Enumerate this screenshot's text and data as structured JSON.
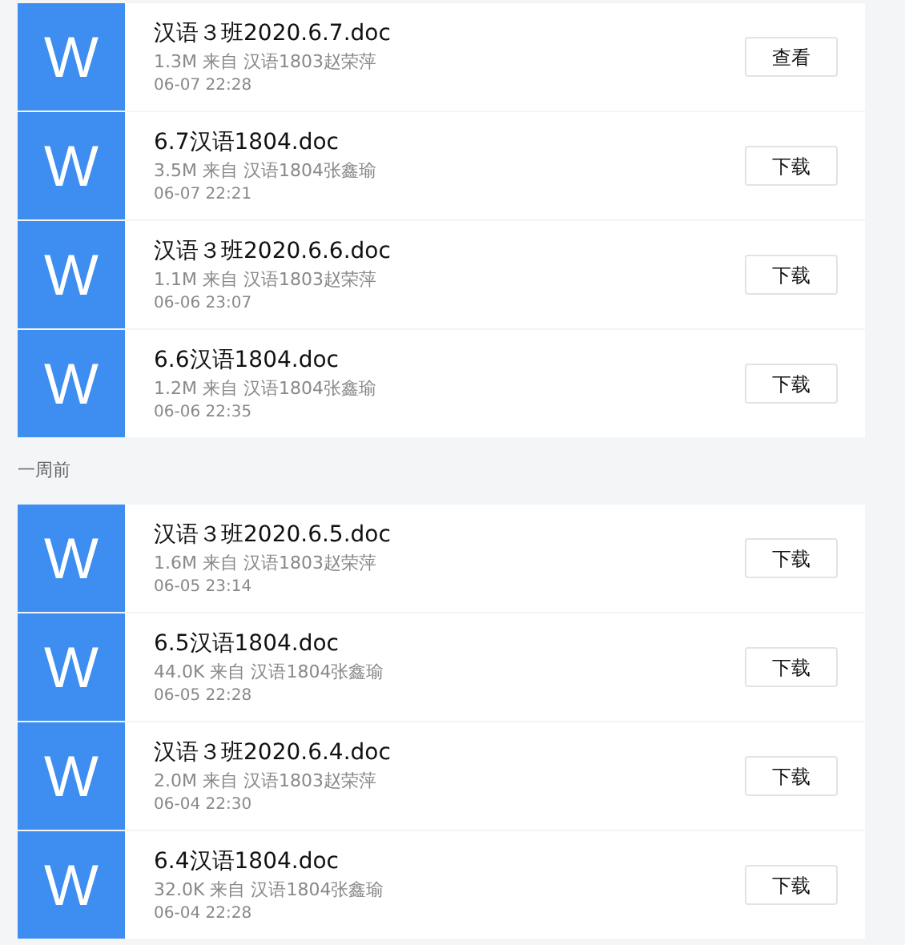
{
  "groups": [
    {
      "files": [
        {
          "icon": "W",
          "name": "汉语３班2020.6.7.doc",
          "meta": "1.3M 来自 汉语1803赵荣萍",
          "time": "06-07 22:28",
          "action": "查看"
        },
        {
          "icon": "W",
          "name": "6.7汉语1804.doc",
          "meta": "3.5M 来自 汉语1804张鑫瑜",
          "time": "06-07 22:21",
          "action": "下载"
        },
        {
          "icon": "W",
          "name": "汉语３班2020.6.6.doc",
          "meta": "1.1M 来自 汉语1803赵荣萍",
          "time": "06-06 23:07",
          "action": "下载"
        },
        {
          "icon": "W",
          "name": "6.6汉语1804.doc",
          "meta": "1.2M 来自 汉语1804张鑫瑜",
          "time": "06-06 22:35",
          "action": "下载"
        }
      ]
    },
    {
      "heading": "一周前",
      "files": [
        {
          "icon": "W",
          "name": "汉语３班2020.6.5.doc",
          "meta": "1.6M 来自 汉语1803赵荣萍",
          "time": "06-05 23:14",
          "action": "下载"
        },
        {
          "icon": "W",
          "name": "6.5汉语1804.doc",
          "meta": "44.0K 来自 汉语1804张鑫瑜",
          "time": "06-05 22:28",
          "action": "下载"
        },
        {
          "icon": "W",
          "name": "汉语３班2020.6.4.doc",
          "meta": "2.0M 来自 汉语1803赵荣萍",
          "time": "06-04 22:30",
          "action": "下载"
        },
        {
          "icon": "W",
          "name": "6.4汉语1804.doc",
          "meta": "32.0K 来自 汉语1804张鑫瑜",
          "time": "06-04 22:28",
          "action": "下载"
        }
      ]
    }
  ]
}
